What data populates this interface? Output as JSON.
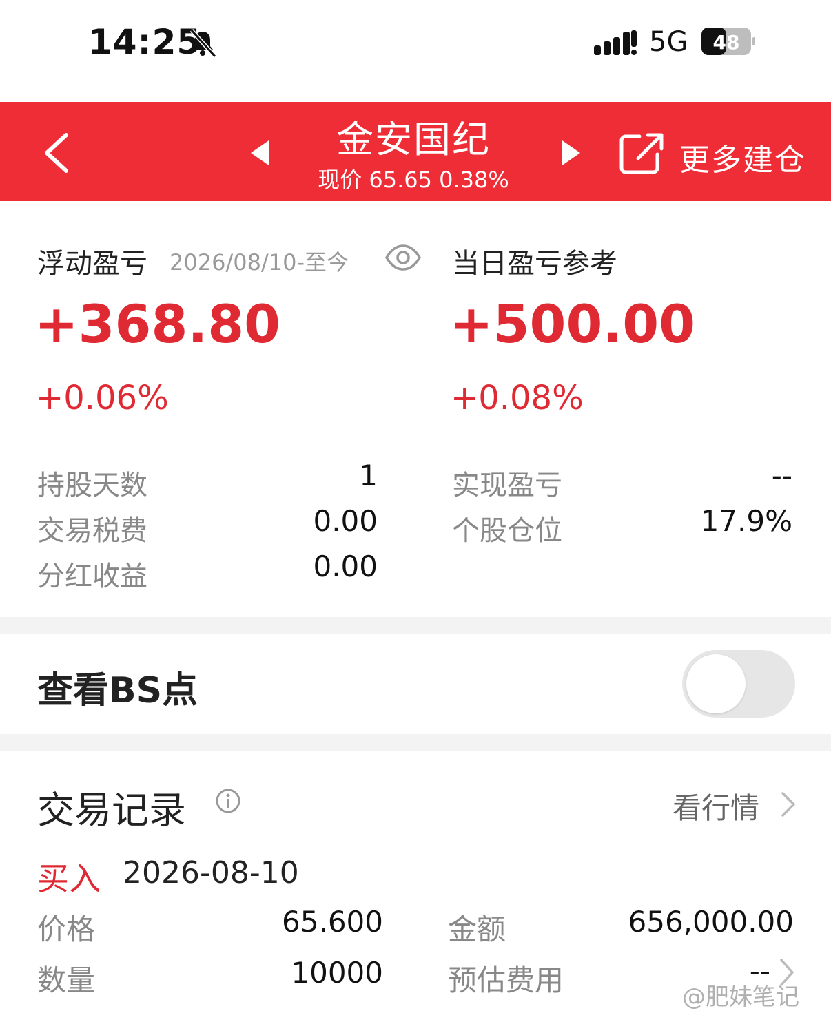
{
  "status_bar": {
    "time": "14:25",
    "network": "5G",
    "battery": "48"
  },
  "header": {
    "title": "金安国纪",
    "subtitle": "现价 65.65 0.38%",
    "more_label": "更多建仓",
    "bg_color": "#ef2d36"
  },
  "pnl": {
    "floating": {
      "label": "浮动盈亏",
      "period": "2026/08/10-至今",
      "value": "+368.80",
      "pct": "+0.06%"
    },
    "daily": {
      "label": "当日盈亏参考",
      "value": "+500.00",
      "pct": "+0.08%"
    },
    "left_stats": [
      {
        "label": "持股天数",
        "value": "1"
      },
      {
        "label": "交易税费",
        "value": "0.00"
      },
      {
        "label": "分红收益",
        "value": "0.00"
      }
    ],
    "right_stats": [
      {
        "label": "实现盈亏",
        "value": "--"
      },
      {
        "label": "个股仓位",
        "value": "17.9%"
      }
    ]
  },
  "bs_points": {
    "label": "查看BS点",
    "enabled": false
  },
  "records": {
    "title": "交易记录",
    "view_market": "看行情",
    "items": [
      {
        "type": "买入",
        "date": "2026-08-10",
        "price_label": "价格",
        "price": "65.600",
        "amount_label": "金额",
        "amount": "656,000.00",
        "qty_label": "数量",
        "qty": "10000",
        "fee_label": "预估费用",
        "fee": "--"
      }
    ]
  },
  "watermark": "@肥妹笔记",
  "accent_red": "#e02a33"
}
